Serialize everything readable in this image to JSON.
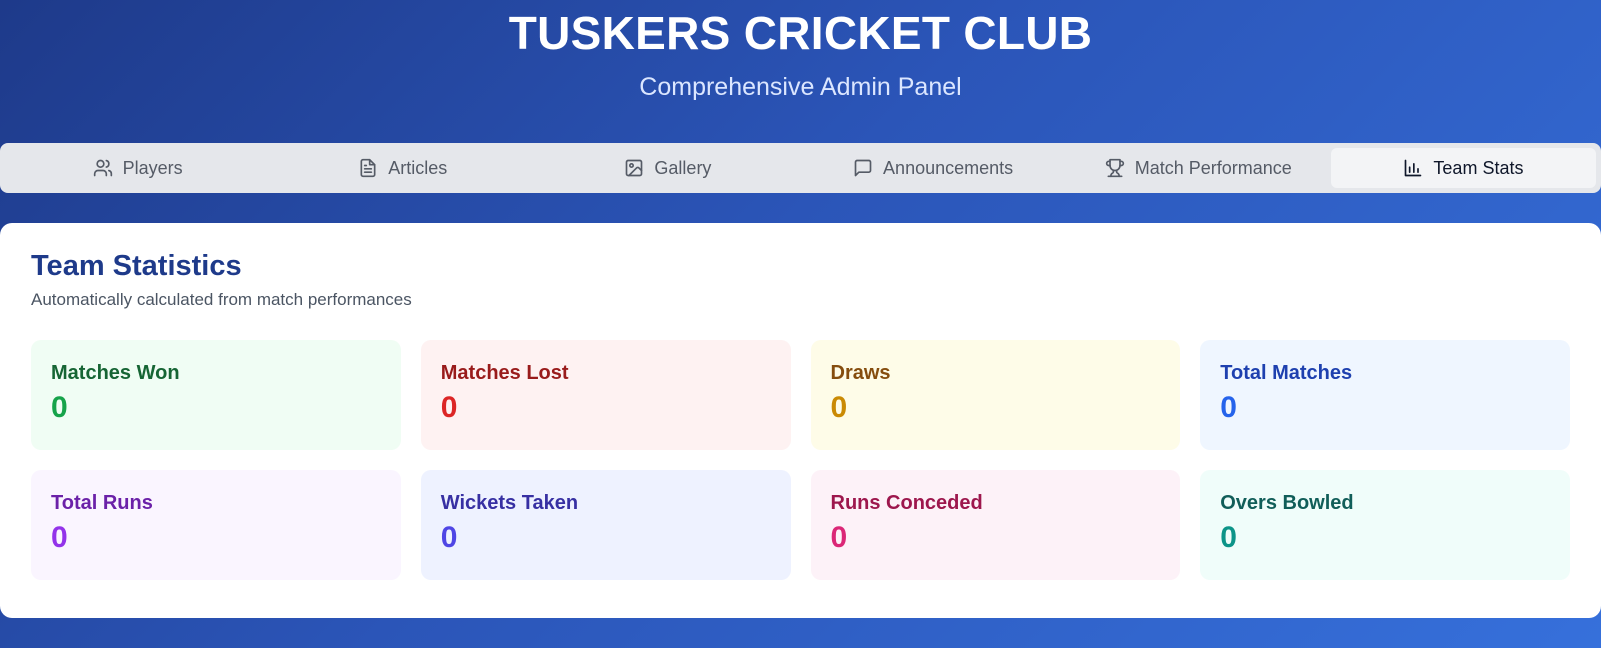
{
  "header": {
    "title": "TUSKERS CRICKET CLUB",
    "subtitle": "Comprehensive Admin Panel"
  },
  "tabs": [
    {
      "label": "Players",
      "icon": "users-icon",
      "active": false
    },
    {
      "label": "Articles",
      "icon": "document-icon",
      "active": false
    },
    {
      "label": "Gallery",
      "icon": "image-icon",
      "active": false
    },
    {
      "label": "Announcements",
      "icon": "message-icon",
      "active": false
    },
    {
      "label": "Match Performance",
      "icon": "trophy-icon",
      "active": false
    },
    {
      "label": "Team Stats",
      "icon": "bar-chart-icon",
      "active": true
    }
  ],
  "panel": {
    "title": "Team Statistics",
    "description": "Automatically calculated from match performances"
  },
  "stats": [
    {
      "label": "Matches Won",
      "value": "0",
      "color": "#16a34a"
    },
    {
      "label": "Matches Lost",
      "value": "0",
      "color": "#dc2626"
    },
    {
      "label": "Draws",
      "value": "0",
      "color": "#ca8a04"
    },
    {
      "label": "Total Matches",
      "value": "0",
      "color": "#2563eb"
    },
    {
      "label": "Total Runs",
      "value": "0",
      "color": "#9333ea"
    },
    {
      "label": "Wickets Taken",
      "value": "0",
      "color": "#4f46e5"
    },
    {
      "label": "Runs Conceded",
      "value": "0",
      "color": "#db2777"
    },
    {
      "label": "Overs Bowled",
      "value": "0",
      "color": "#0d9488"
    }
  ]
}
